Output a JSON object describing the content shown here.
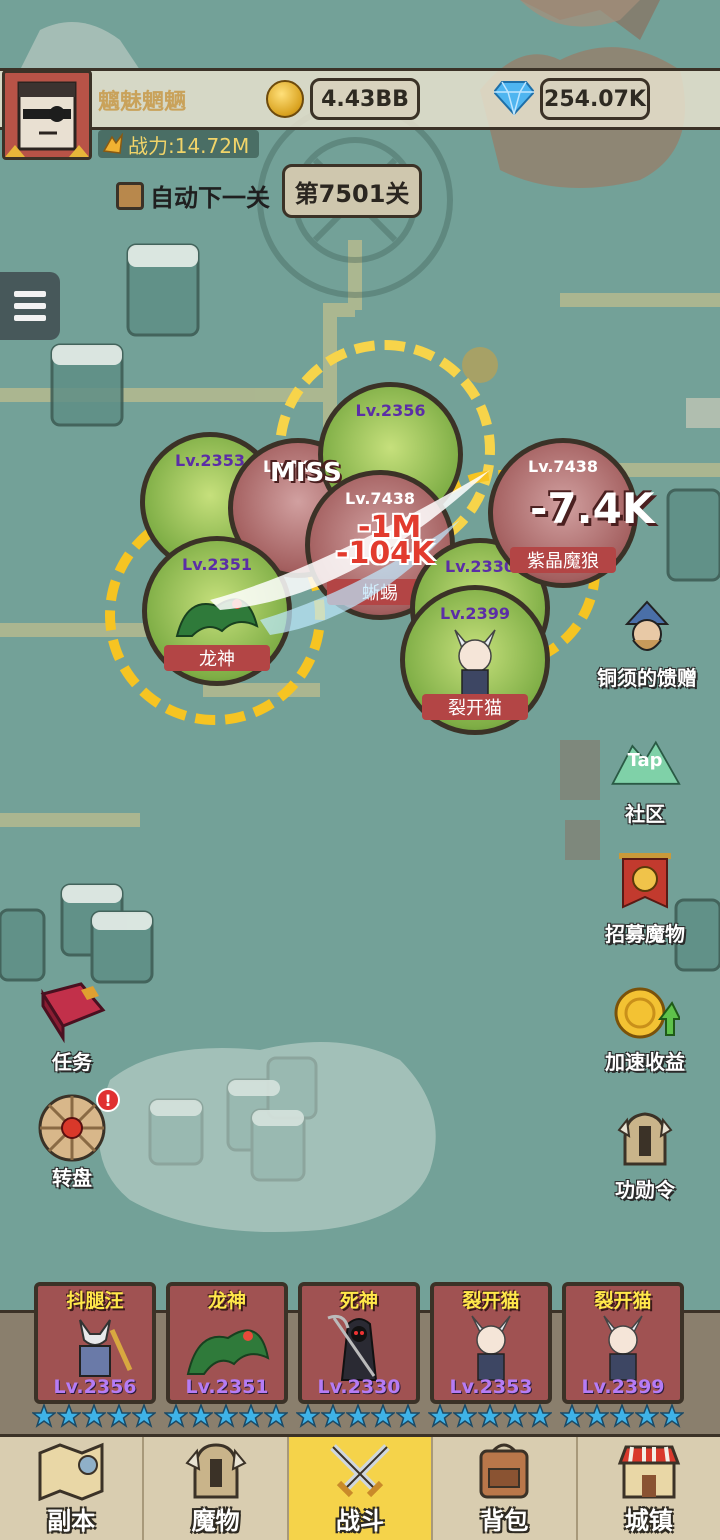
{
  "player": {
    "name": "魑魅魍魉",
    "power_label": "战力:14.72M",
    "gold": "4.43BB",
    "gems": "254.07K"
  },
  "stage": {
    "auto_next_label": "自动下一关",
    "stage_label": "第7501关"
  },
  "battle": {
    "friendly_units": [
      {
        "level": "Lv.2356",
        "name": ""
      },
      {
        "level": "Lv.2353",
        "name": ""
      },
      {
        "level": "Lv.2351",
        "name": "龙神"
      },
      {
        "level": "Lv.2399",
        "name": "裂开猫"
      },
      {
        "level": "Lv.2330",
        "name": ""
      }
    ],
    "enemy_units": [
      {
        "level": "Lv.7438",
        "name": ""
      },
      {
        "level": "Lv.7438",
        "name": "蜥蜴"
      },
      {
        "level": "Lv.7438",
        "name": "紫晶魔狼"
      }
    ],
    "damage_texts": [
      "-1M",
      "-104K",
      "-7.4K",
      "MISS"
    ]
  },
  "side_buttons": {
    "gift": "铜须的馈赠",
    "community": "社区",
    "community_tap": "Tap",
    "recruit": "招募魔物",
    "speedup": "加速收益",
    "merit": "功勋令",
    "quest": "任务",
    "wheel": "转盘",
    "wheel_badge": "!"
  },
  "team": [
    {
      "name": "抖腿汪",
      "level": "Lv.2356",
      "stars": 5
    },
    {
      "name": "龙神",
      "level": "Lv.2351",
      "stars": 5
    },
    {
      "name": "死神",
      "level": "Lv.2330",
      "stars": 5
    },
    {
      "name": "裂开猫",
      "level": "Lv.2353",
      "stars": 5
    },
    {
      "name": "裂开猫",
      "level": "Lv.2399",
      "stars": 5
    }
  ],
  "nav": [
    {
      "label": "副本",
      "icon": "map-icon"
    },
    {
      "label": "魔物",
      "icon": "helmet-icon"
    },
    {
      "label": "战斗",
      "icon": "swords-icon",
      "active": true
    },
    {
      "label": "背包",
      "icon": "backpack-icon"
    },
    {
      "label": "城镇",
      "icon": "shop-icon"
    }
  ],
  "colors": {
    "map_bg": "#73a198",
    "active_nav": "#f5d34a",
    "level_text": "#5b2ea6",
    "damage": "#e23b2e"
  }
}
